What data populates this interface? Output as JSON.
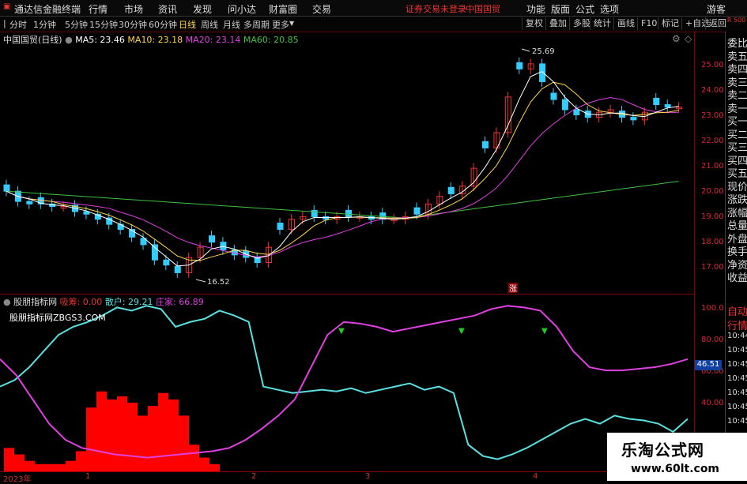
{
  "titlebar": {
    "app_title": "通达信金融终端",
    "menus": [
      "行情",
      "市场",
      "资讯",
      "发现",
      "问小达",
      "财富圈",
      "交易"
    ],
    "status": "证券交易未登录",
    "stock": "中国国贸",
    "right_menus": [
      "功能",
      "版面",
      "公式",
      "选项"
    ],
    "guest": "游客"
  },
  "toolbar": {
    "periods": [
      "分时",
      "1分钟",
      "5分钟",
      "15分钟",
      "30分钟",
      "60分钟",
      "日线",
      "周线",
      "月线",
      "多周期",
      "更多"
    ],
    "selected": "日线",
    "buttons": [
      "复权",
      "叠加",
      "多股",
      "统计",
      "画线",
      "F10",
      "标记",
      "+自选",
      "返回"
    ]
  },
  "main_legend": {
    "name": "中国国贸(日线)",
    "ma5": "MA5: 23.46",
    "ma10": "MA10: 23.18",
    "ma20": "MA20: 23.14",
    "ma60": "MA60: 20.85"
  },
  "annotations": {
    "high": "25.69",
    "low": "16.52",
    "zhang": "涨"
  },
  "y_ticks_main": [
    "25.00",
    "24.00",
    "23.00",
    "22.00",
    "21.00",
    "20.00",
    "19.00",
    "18.00",
    "17.00"
  ],
  "sub_legend": {
    "name": "股朋指标网",
    "a": "吸筹: 0.00",
    "b": "散户: 29.21",
    "c": "庄家: 66.89",
    "site": "股朋指标网ZBGS3.COM"
  },
  "y_ticks_sub": [
    "100.0",
    "80.00",
    "60.00",
    "40.00"
  ],
  "sub_value_badge": "46.51",
  "x_labels": [
    "2023年",
    "1",
    "2",
    "3",
    "4"
  ],
  "right_panel": [
    "委比",
    "卖五",
    "卖四",
    "卖三",
    "卖二",
    "卖一",
    "买一",
    "买二",
    "买三",
    "买四",
    "买五",
    "现价",
    "涨跌",
    "涨幅",
    "总量",
    "外盘",
    "换手",
    "净资",
    "收益"
  ],
  "right_panel2": [
    "自动",
    "行情",
    "10:44",
    "10:45",
    "10:45",
    "10:45",
    "10:45",
    "10:45",
    "10:45"
  ],
  "right_top_badge": "R 500",
  "watermark": {
    "title": "乐淘公式网",
    "url": "www.60lt.com"
  },
  "colors": {
    "ma5": "#ffffff",
    "ma10": "#ffd54a",
    "ma20": "#e040e0",
    "ma60": "#40c040",
    "up": "#e33",
    "down": "#3cf",
    "retail": "#59e0e0",
    "banker": "#e040e0",
    "absorb": "#ff0000"
  }
}
